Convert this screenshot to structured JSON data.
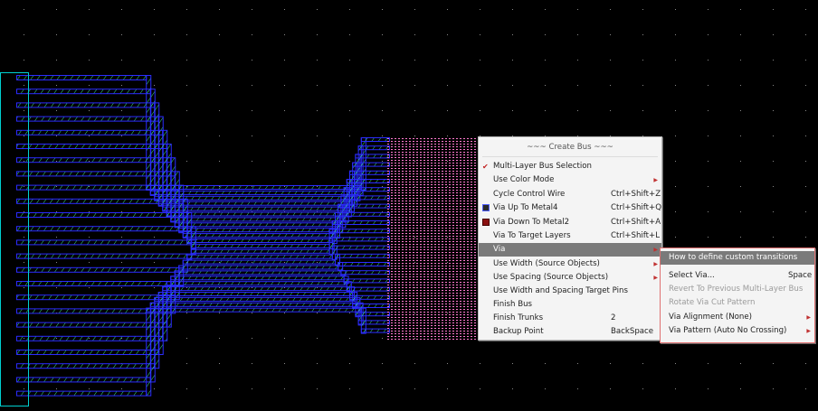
{
  "colors": {
    "background": "#000000",
    "metal_outline": "#2b2bff",
    "metal_fill_hatch": "#37e08a",
    "pin_outline": "#00d0d0",
    "pin_pattern": "#ff7ad0",
    "menu_bg": "#f4f4f4",
    "menu_highlight": "#7a7a7a",
    "checkmark": "#c02020"
  },
  "context_menu": {
    "title": "~~~ Create Bus ~~~",
    "items": [
      {
        "label": "Multi-Layer Bus Selection",
        "shortcut": "",
        "checked": true,
        "submenu": false,
        "icon": ""
      },
      {
        "label": "Use Color Mode",
        "shortcut": "",
        "checked": false,
        "submenu": true,
        "icon": ""
      },
      {
        "label": "Cycle Control Wire",
        "shortcut": "Ctrl+Shift+Z",
        "checked": false,
        "submenu": false,
        "icon": ""
      },
      {
        "label": "Via Up To Metal4",
        "shortcut": "Ctrl+Shift+Q",
        "checked": false,
        "submenu": false,
        "icon": "via-up-icon"
      },
      {
        "label": "Via Down To Metal2",
        "shortcut": "Ctrl+Shift+A",
        "checked": false,
        "submenu": false,
        "icon": "via-down-icon"
      },
      {
        "label": "Via To Target Layers",
        "shortcut": "Ctrl+Shift+L",
        "checked": false,
        "submenu": false,
        "icon": ""
      },
      {
        "label": "Via",
        "shortcut": "",
        "checked": false,
        "submenu": true,
        "icon": "",
        "highlighted": true
      },
      {
        "label": "Use Width (Source Objects)",
        "shortcut": "",
        "checked": false,
        "submenu": true,
        "icon": ""
      },
      {
        "label": "Use Spacing (Source Objects)",
        "shortcut": "",
        "checked": false,
        "submenu": true,
        "icon": ""
      },
      {
        "label": "Use Width and Spacing Target Pins",
        "shortcut": "",
        "checked": false,
        "submenu": false,
        "icon": ""
      },
      {
        "label": "Finish Bus",
        "shortcut": "",
        "checked": false,
        "submenu": false,
        "icon": ""
      },
      {
        "label": "Finish Trunks",
        "shortcut": "2",
        "checked": false,
        "submenu": false,
        "icon": ""
      },
      {
        "label": "Backup Point",
        "shortcut": "BackSpace",
        "checked": false,
        "submenu": false,
        "icon": ""
      }
    ]
  },
  "via_submenu": {
    "items": [
      {
        "label": "How to define custom transitions",
        "shortcut": "",
        "submenu": false,
        "disabled": false,
        "highlighted": true
      },
      {
        "label": "Select Via...",
        "shortcut": "Space",
        "submenu": false,
        "disabled": false
      },
      {
        "label": "Revert To Previous Multi-Layer Bus",
        "shortcut": "",
        "submenu": false,
        "disabled": true
      },
      {
        "label": "Rotate Via Cut Pattern",
        "shortcut": "",
        "submenu": false,
        "disabled": true
      },
      {
        "label": "Via Alignment (None)",
        "shortcut": "",
        "submenu": true,
        "disabled": false
      },
      {
        "label": "Via Pattern (Auto No Crossing)",
        "shortcut": "",
        "submenu": true,
        "disabled": false
      }
    ]
  }
}
